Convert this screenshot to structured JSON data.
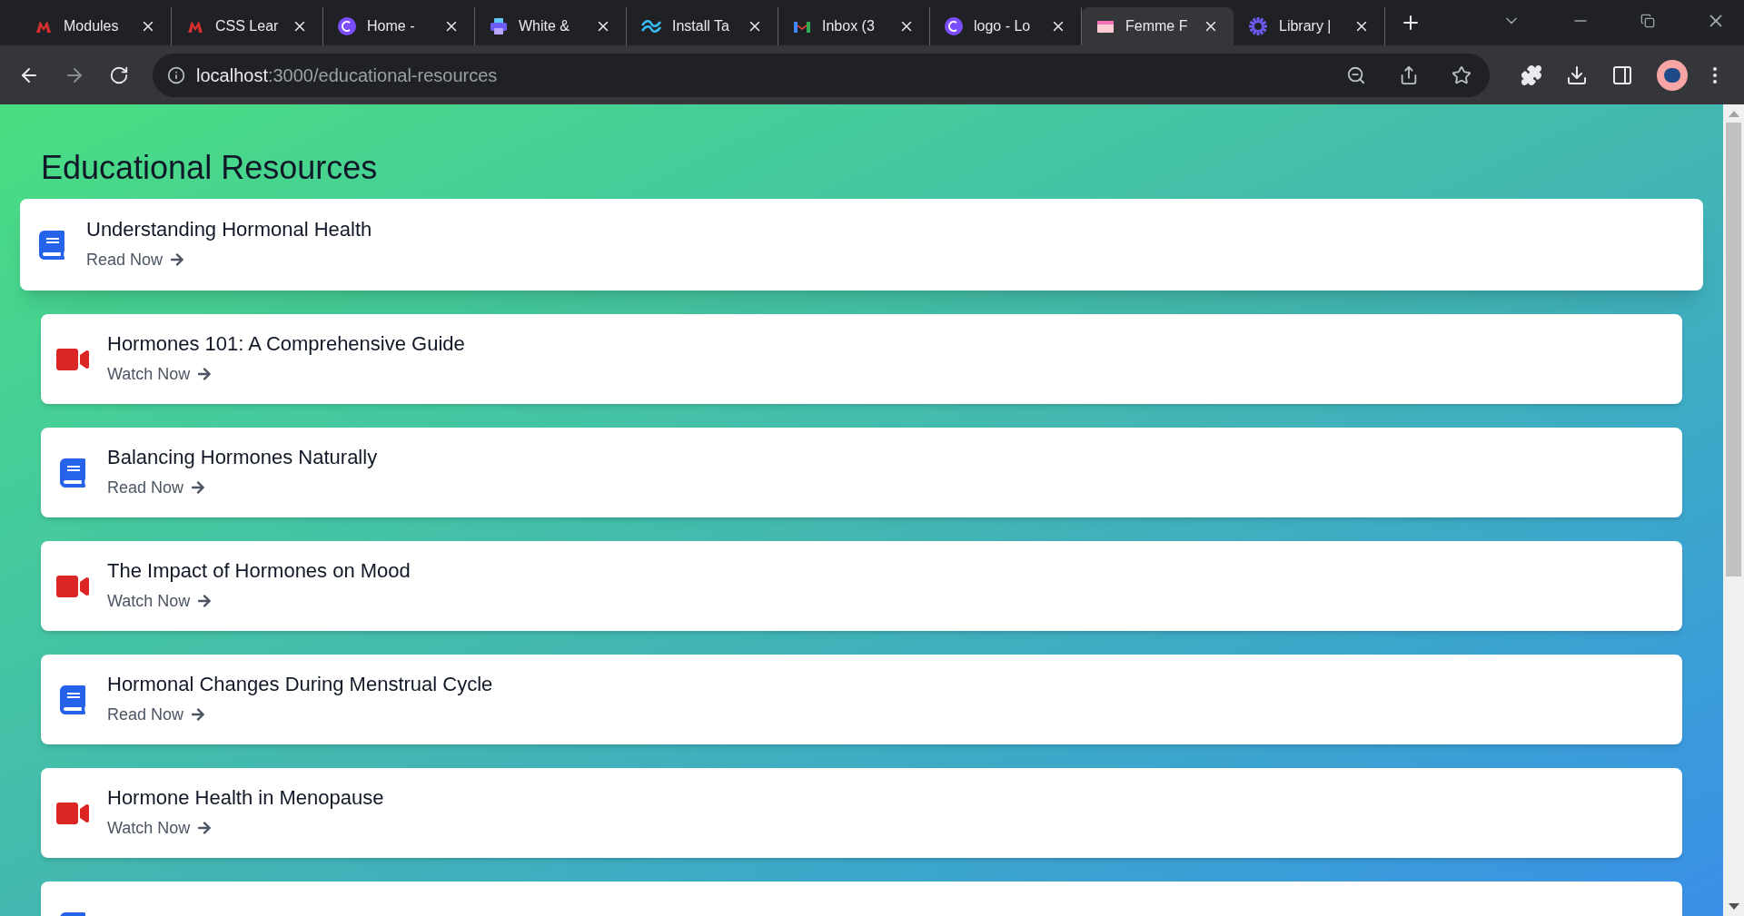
{
  "browser": {
    "tabs": [
      {
        "title": "Modules",
        "selected": false
      },
      {
        "title": "CSS Lear",
        "selected": false
      },
      {
        "title": "Home -",
        "selected": false
      },
      {
        "title": "White &",
        "selected": false
      },
      {
        "title": "Install Ta",
        "selected": false
      },
      {
        "title": "Inbox (3",
        "selected": false
      },
      {
        "title": "logo - Lo",
        "selected": false
      },
      {
        "title": "Femme F",
        "selected": true
      },
      {
        "title": "Library |",
        "selected": false
      }
    ],
    "address": {
      "host": "localhost",
      "path": ":3000/educational-resources"
    }
  },
  "page": {
    "title": "Educational Resources",
    "resources": [
      {
        "kind": "read",
        "title": "Understanding Hormonal Health",
        "action": "Read Now",
        "highlighted": true
      },
      {
        "kind": "watch",
        "title": "Hormones 101: A Comprehensive Guide",
        "action": "Watch Now",
        "highlighted": false
      },
      {
        "kind": "read",
        "title": "Balancing Hormones Naturally",
        "action": "Read Now",
        "highlighted": false
      },
      {
        "kind": "watch",
        "title": "The Impact of Hormones on Mood",
        "action": "Watch Now",
        "highlighted": false
      },
      {
        "kind": "read",
        "title": "Hormonal Changes During Menstrual Cycle",
        "action": "Read Now",
        "highlighted": false
      },
      {
        "kind": "watch",
        "title": "Hormone Health in Menopause",
        "action": "Watch Now",
        "highlighted": false
      },
      {
        "kind": "read",
        "highlighted": false
      }
    ]
  }
}
